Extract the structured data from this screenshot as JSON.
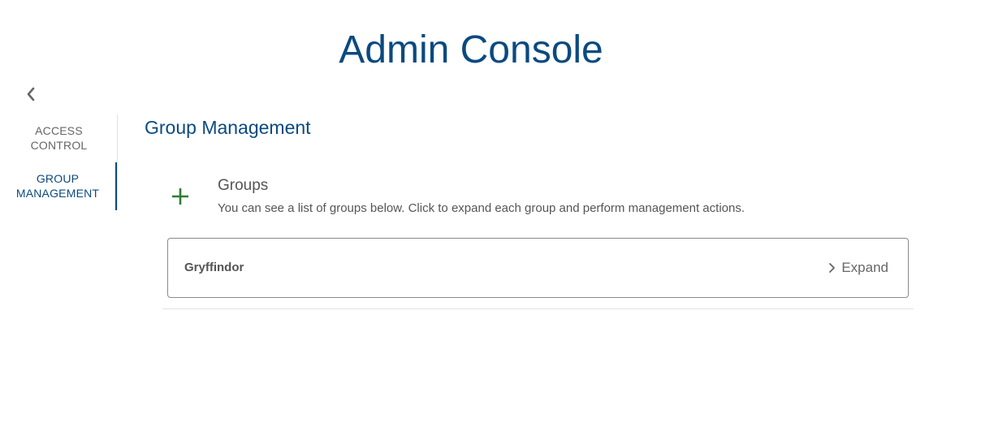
{
  "header": {
    "title": "Admin Console",
    "back_icon": "chevron-left-icon"
  },
  "sidebar": {
    "items": [
      {
        "line1": "ACCESS",
        "line2": "CONTROL",
        "active": false
      },
      {
        "line1": "GROUP",
        "line2": "MANAGEMENT",
        "active": true
      }
    ]
  },
  "main": {
    "section_title": "Group Management",
    "groups": {
      "add_icon": "plus-icon",
      "heading": "Groups",
      "description": "You can see a list of groups below. Click to expand each group and perform management actions.",
      "list": [
        {
          "name": "Gryffindor",
          "action_label": "Expand",
          "action_icon": "chevron-right-icon"
        }
      ]
    }
  },
  "colors": {
    "brand": "#0a4a80",
    "add_icon": "#2e7d32",
    "text": "#555555",
    "border": "#8a8a8a"
  }
}
